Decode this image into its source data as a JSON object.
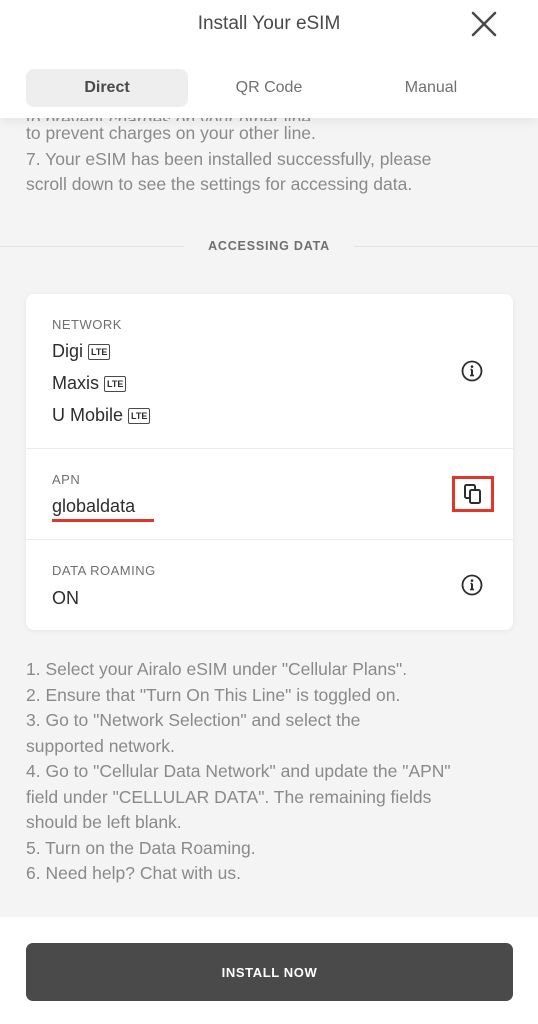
{
  "header": {
    "title": "Install Your eSIM",
    "close_icon": "close-icon",
    "tabs": [
      {
        "label": "Direct",
        "active": true
      },
      {
        "label": "QR Code",
        "active": false
      },
      {
        "label": "Manual",
        "active": false
      }
    ]
  },
  "intro_text": {
    "line_cut": "to prevent charges on your other line.",
    "step7_line1": "7. Your eSIM has been installed successfully, please",
    "step7_line2": "scroll down to see the settings for accessing data."
  },
  "section_title": "ACCESSING DATA",
  "card": {
    "network_label": "NETWORK",
    "networks": [
      {
        "name": "Digi",
        "badge": "LTE"
      },
      {
        "name": "Maxis",
        "badge": "LTE"
      },
      {
        "name": "U Mobile",
        "badge": "LTE"
      }
    ],
    "apn_label": "APN",
    "apn_value": "globaldata",
    "roaming_label": "DATA ROAMING",
    "roaming_value": "ON"
  },
  "steps": [
    "1. Select your Airalo eSIM under \"Cellular Plans\".",
    "2. Ensure that \"Turn On This Line\" is toggled on.",
    "3. Go to \"Network Selection\" and select the",
    "supported network.",
    "4. Go to \"Cellular Data Network\" and update the \"APN\"",
    "field under \"CELLULAR DATA\". The remaining fields",
    "should be left blank.",
    "5. Turn on the Data Roaming.",
    "6. Need help? Chat with us."
  ],
  "footer": {
    "install_label": "INSTALL NOW"
  },
  "colors": {
    "highlight": "#e3352a",
    "button": "#4a4a4a",
    "background": "#f4f4f4"
  }
}
